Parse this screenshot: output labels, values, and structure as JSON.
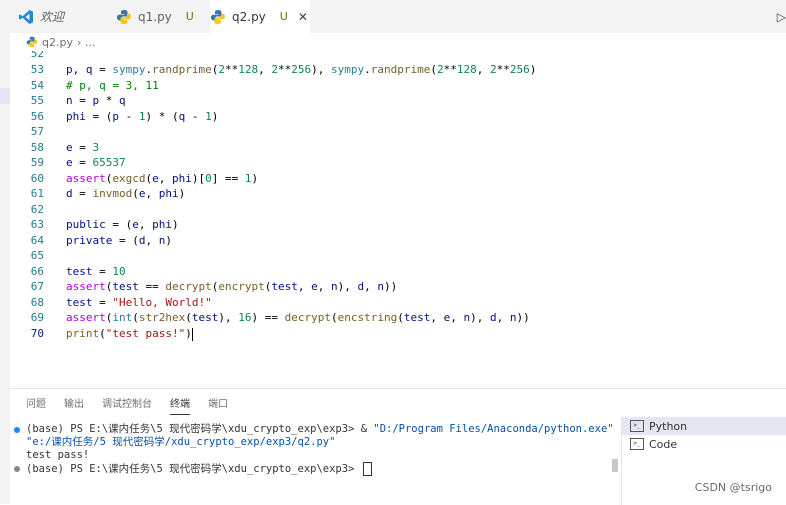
{
  "tabs": [
    {
      "label": "欢迎",
      "icon": "vscode-logo-icon",
      "status": "",
      "active": false
    },
    {
      "label": "q1.py",
      "icon": "python-icon",
      "status": "U",
      "active": false
    },
    {
      "label": "q2.py",
      "icon": "python-icon",
      "status": "U",
      "active": true
    }
  ],
  "breadcrumb": {
    "file": "q2.py",
    "sep": "› ..."
  },
  "editor": {
    "lines": [
      {
        "n": "52",
        "text": ""
      },
      {
        "n": "53",
        "text": "p, q = sympy.randprime(2**128, 2**256), sympy.randprime(2**128, 2**256)"
      },
      {
        "n": "54",
        "text": "# p, q = 3, 11"
      },
      {
        "n": "55",
        "text": "n = p * q"
      },
      {
        "n": "56",
        "text": "phi = (p - 1) * (q - 1)"
      },
      {
        "n": "57",
        "text": ""
      },
      {
        "n": "58",
        "text": "e = 3"
      },
      {
        "n": "59",
        "text": "e = 65537"
      },
      {
        "n": "60",
        "text": "assert(exgcd(e, phi)[0] == 1)"
      },
      {
        "n": "61",
        "text": "d = invmod(e, phi)"
      },
      {
        "n": "62",
        "text": ""
      },
      {
        "n": "63",
        "text": "public = (e, phi)"
      },
      {
        "n": "64",
        "text": "private = (d, n)"
      },
      {
        "n": "65",
        "text": ""
      },
      {
        "n": "66",
        "text": "test = 10"
      },
      {
        "n": "67",
        "text": "assert(test == decrypt(encrypt(test, e, n), d, n))"
      },
      {
        "n": "68",
        "text": "test = \"Hello, World!\""
      },
      {
        "n": "69",
        "text": "assert(int(str2hex(test), 16) == decrypt(encstring(test, e, n), d, n))"
      },
      {
        "n": "70",
        "text": "print(\"test pass!\")"
      }
    ]
  },
  "panel": {
    "tabs": [
      "问题",
      "输出",
      "调试控制台",
      "终端",
      "端口"
    ],
    "active_tab": "终端"
  },
  "terminal": {
    "line1_prompt": "(base) PS E:\\课内任务\\5 现代密码学\\xdu_crypto_exp\\exp3> & ",
    "line1_cmd": "\"D:/Program Files/Anaconda/python.exe\"",
    "line2": "\"e:/课内任务/5 现代密码学/xdu_crypto_exp/exp3/q2.py\"",
    "line3": "test pass!",
    "line4": "(base) PS E:\\课内任务\\5 现代密码学\\xdu_crypto_exp\\exp3> "
  },
  "terminal_list": [
    {
      "label": "Python",
      "selected": true
    },
    {
      "label": "Code",
      "selected": false
    }
  ],
  "watermark": "CSDN @tsrigo",
  "colors": {
    "accent": "#1a85ff",
    "keyword": "#af00db",
    "function": "#795e26",
    "number": "#098658",
    "string": "#a31515",
    "comment": "#008000"
  }
}
